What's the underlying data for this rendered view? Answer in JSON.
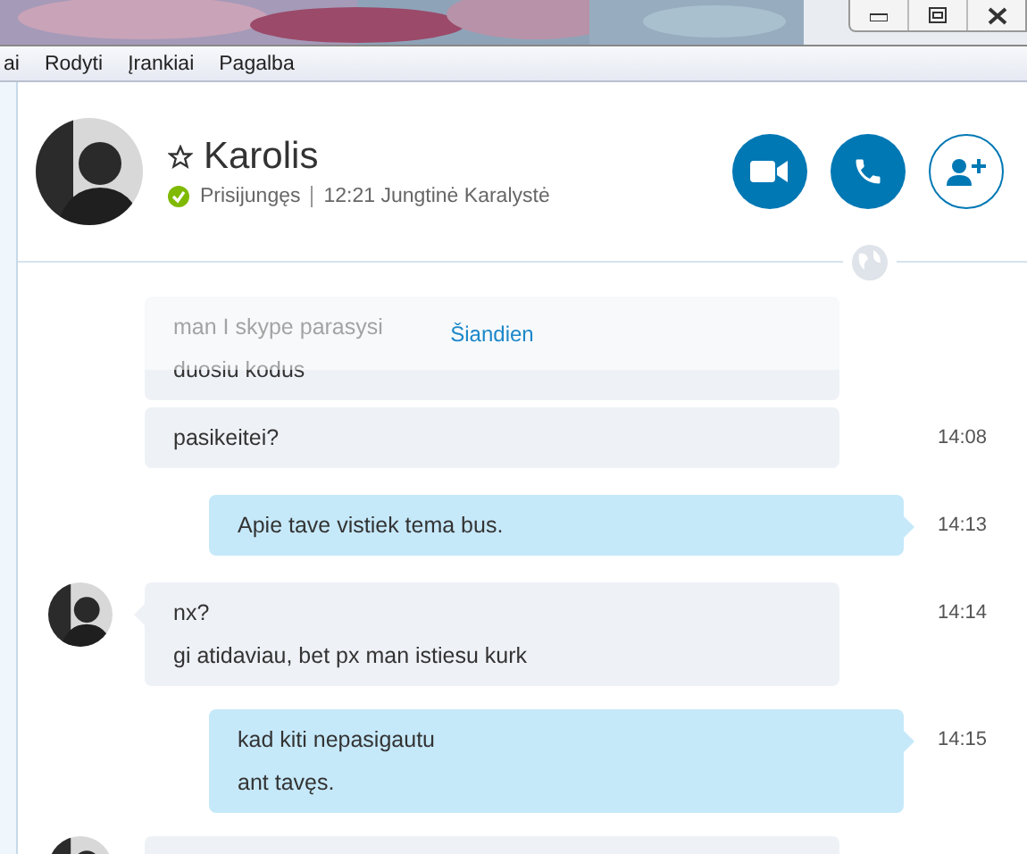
{
  "menu": [
    "ai",
    "Rodyti",
    "Įrankiai",
    "Pagalba"
  ],
  "contact": {
    "name": "Karolis",
    "favorite": false,
    "status": "Prisijungęs",
    "local_time": "12:21 Jungtinė Karalystė"
  },
  "date_divider": "Šiandien",
  "messages": [
    {
      "kind": "incoming",
      "show_avatar": false,
      "lines": [
        "man I skype parasysi",
        "duosiu kodus"
      ]
    },
    {
      "kind": "incoming",
      "show_avatar": false,
      "lines": [
        "pasikeitei?"
      ],
      "time": "14:08"
    },
    {
      "kind": "outgoing",
      "show_avatar": false,
      "lines": [
        "Apie tave vistiek tema bus."
      ],
      "time": "14:13"
    },
    {
      "kind": "incoming",
      "show_avatar": true,
      "lines": [
        "nx?",
        "gi atidaviau, bet px man istiesu kurk"
      ],
      "time": "14:14"
    },
    {
      "kind": "outgoing",
      "show_avatar": false,
      "lines": [
        "kad kiti nepasigautu",
        "ant tavęs."
      ],
      "time": "14:15"
    },
    {
      "kind": "incoming",
      "show_avatar": true
    }
  ]
}
